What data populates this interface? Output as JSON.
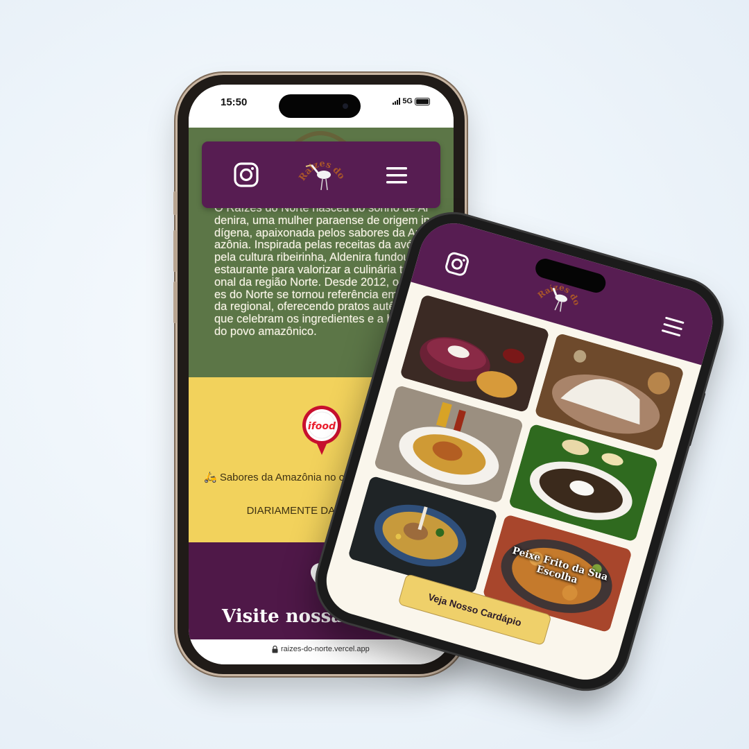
{
  "phone1": {
    "status_time": "15:50",
    "network": "5G",
    "story_text": "O Raízes do Norte nasceu do sonho de Aldenira, uma mulher paraense de origem indígena, apaixonada pelos sabores da Amazônia. Inspirada pelas receitas da avó e pela cultura ribeirinha, Aldenira fundou o restaurante para valorizar a culinária tradicional da região Norte. Desde 2012, o Raízes do Norte se tornou referência em comida regional, oferecendo pratos autênticos que celebram os ingredientes e a história do povo amazônico.",
    "ifood_label": "ifood",
    "delivery_text": "🛵 Sabores da Amazônia no conforto da sua casa:",
    "delivery_hours": "DIARIAMENTE DAS 11h às 22h",
    "visit_title": "Visite nossa unidade",
    "url": "raizes-do-norte.vercel.app"
  },
  "brand": {
    "logo_text": "Raízes do Norte",
    "colors": {
      "purple": "#571d52",
      "green": "#5c7647",
      "yellow": "#f2d25c",
      "cream": "#faf6ec"
    }
  },
  "phone2": {
    "dishes": [
      {
        "caption": ""
      },
      {
        "caption": ""
      },
      {
        "caption": ""
      },
      {
        "caption": ""
      },
      {
        "caption": ""
      },
      {
        "caption": "Peixe Frito da Sua Escolha"
      }
    ],
    "menu_button": "Veja Nosso Cardápio"
  },
  "icons": [
    "instagram-icon",
    "hamburger-menu-icon",
    "heron-logo",
    "map-pin-icon",
    "lock-icon",
    "ifood-badge-icon"
  ]
}
